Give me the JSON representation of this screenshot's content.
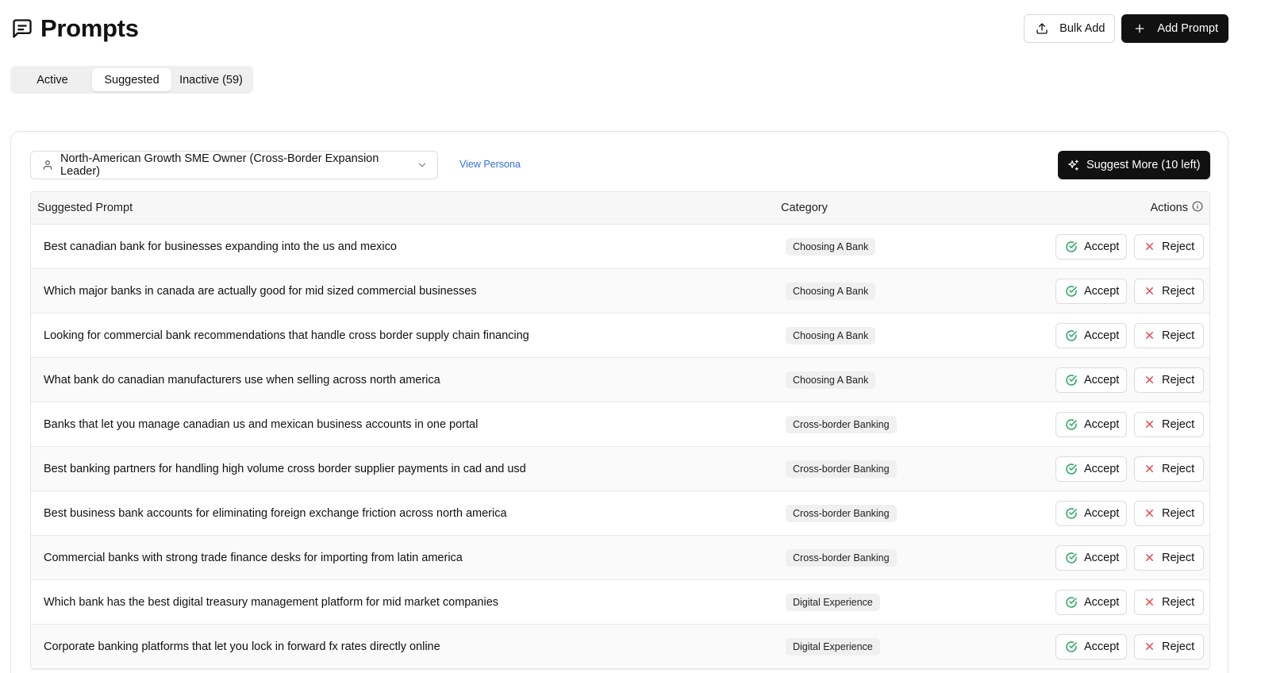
{
  "header": {
    "title": "Prompts",
    "bulk_add_label": "Bulk Add",
    "add_prompt_label": "Add Prompt"
  },
  "tabs": [
    {
      "label": "Active"
    },
    {
      "label": "Suggested"
    },
    {
      "label": "Inactive (59)"
    }
  ],
  "selected_tab": "Suggested",
  "persona": {
    "selected": "North-American Growth SME Owner (Cross-Border Expansion Leader)",
    "view_link": "View Persona"
  },
  "suggest_more_label": "Suggest More (10 left)",
  "table": {
    "headers": {
      "prompt": "Suggested Prompt",
      "category": "Category",
      "actions": "Actions"
    },
    "accept_label": "Accept",
    "reject_label": "Reject",
    "rows": [
      {
        "prompt": "Best canadian bank for businesses expanding into the us and mexico",
        "category": "Choosing A Bank"
      },
      {
        "prompt": "Which major banks in canada are actually good for mid sized commercial businesses",
        "category": "Choosing A Bank"
      },
      {
        "prompt": "Looking for commercial bank recommendations that handle cross border supply chain financing",
        "category": "Choosing A Bank"
      },
      {
        "prompt": "What bank do canadian manufacturers use when selling across north america",
        "category": "Choosing A Bank"
      },
      {
        "prompt": "Banks that let you manage canadian us and mexican business accounts in one portal",
        "category": "Cross-border Banking"
      },
      {
        "prompt": "Best banking partners for handling high volume cross border supplier payments in cad and usd",
        "category": "Cross-border Banking"
      },
      {
        "prompt": "Best business bank accounts for eliminating foreign exchange friction across north america",
        "category": "Cross-border Banking"
      },
      {
        "prompt": "Commercial banks with strong trade finance desks for importing from latin america",
        "category": "Cross-border Banking"
      },
      {
        "prompt": "Which bank has the best digital treasury management platform for mid market companies",
        "category": "Digital Experience"
      },
      {
        "prompt": "Corporate banking platforms that let you lock in forward fx rates directly online",
        "category": "Digital Experience"
      }
    ]
  },
  "colors": {
    "primary_dark": "#111111",
    "accept_green": "#22a45d",
    "reject_red": "#e5484d",
    "link_blue": "#2f6fdf"
  }
}
